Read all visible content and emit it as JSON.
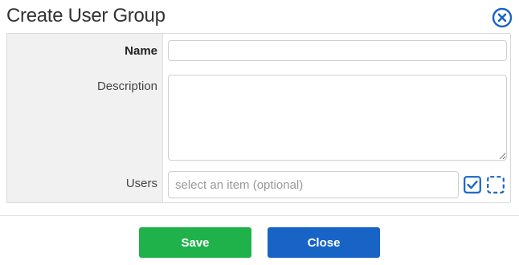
{
  "dialog": {
    "title": "Create User Group"
  },
  "form": {
    "name_label": "Name",
    "name_value": "",
    "description_label": "Description",
    "description_value": "",
    "users_label": "Users",
    "users_placeholder": "select an item (optional)"
  },
  "footer": {
    "save_label": "Save",
    "close_label": "Close"
  },
  "colors": {
    "accent_blue": "#1864c6",
    "save_green": "#1fb24b",
    "label_bg": "#f1f1f1"
  },
  "icons": {
    "close": "close-circle-icon",
    "select_all": "checkbox-checked-icon",
    "deselect_all": "checkbox-dashed-icon"
  }
}
